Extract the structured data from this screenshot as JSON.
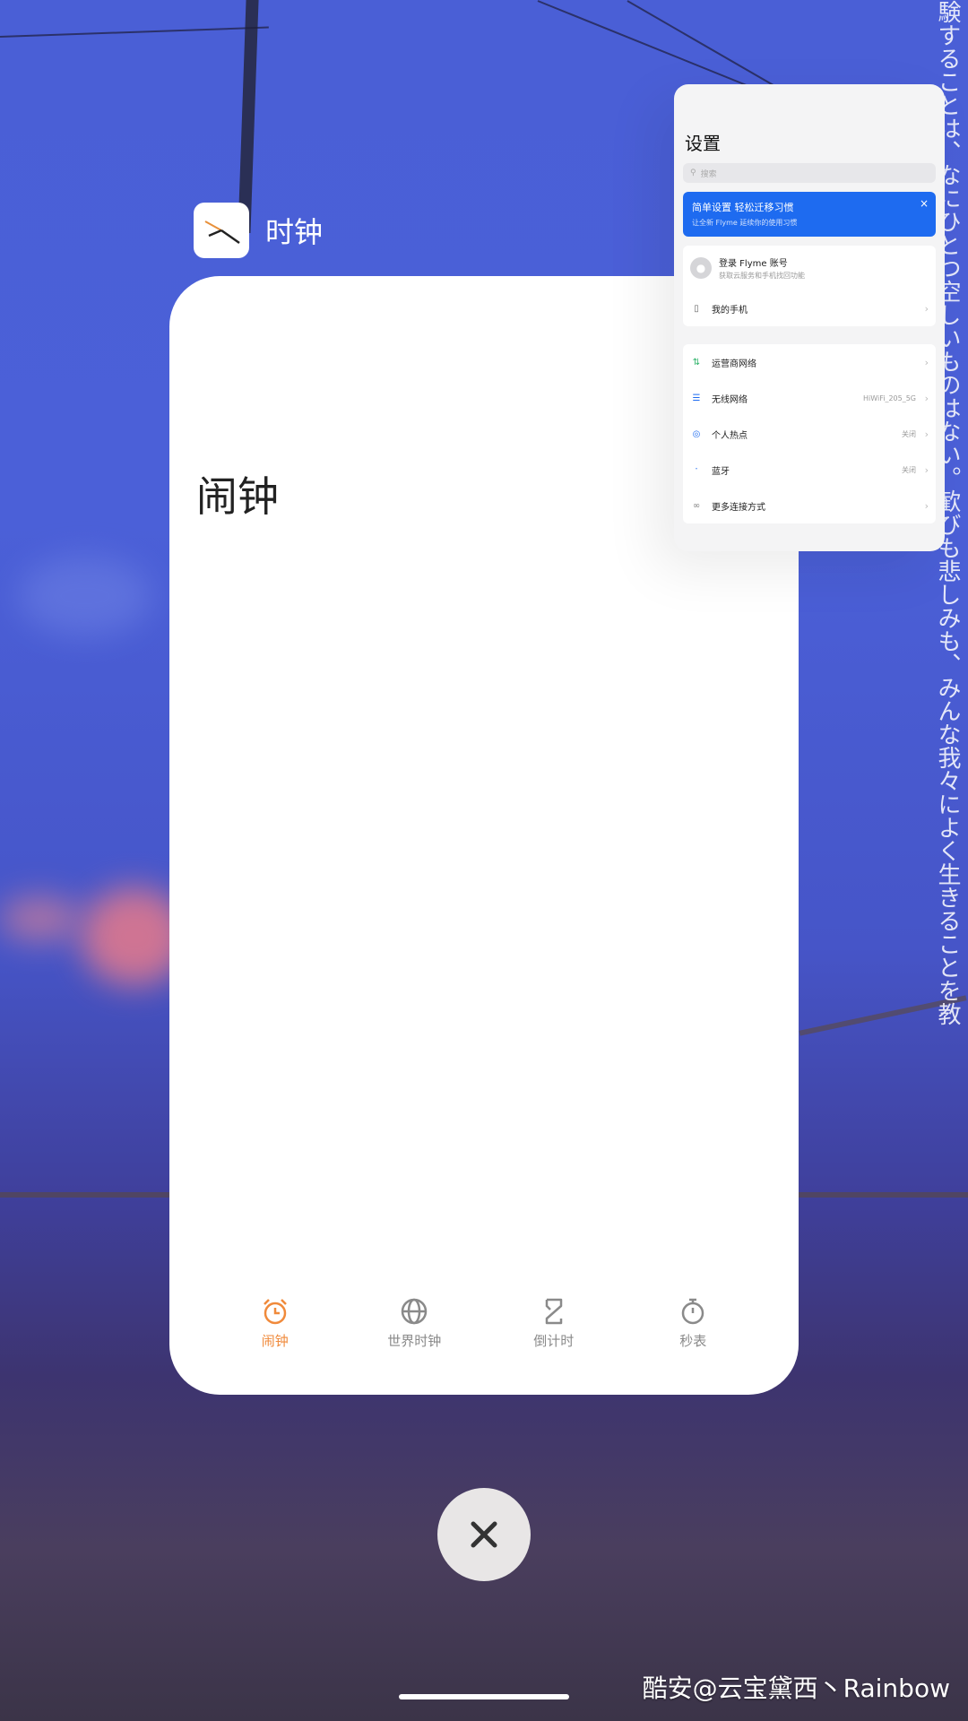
{
  "wallpaper": {
    "vertical_text": "験することは、なにひとつ空しいものはない。歓びも悲しみも、みんな我々によく生きることを教えてくれる。"
  },
  "clock_app": {
    "title": "时钟",
    "page_title": "闹钟",
    "nav": [
      {
        "label": "闹钟",
        "icon": "alarm-icon",
        "active": true
      },
      {
        "label": "世界时钟",
        "icon": "globe-icon",
        "active": false
      },
      {
        "label": "倒计时",
        "icon": "hourglass-icon",
        "active": false
      },
      {
        "label": "秒表",
        "icon": "stopwatch-icon",
        "active": false
      }
    ],
    "accent_color": "#f08a3b"
  },
  "settings_app": {
    "title": "设置",
    "search_placeholder": "搜索",
    "banner": {
      "title": "简单设置 轻松迁移习惯",
      "subtitle": "让全新 Flyme 延续你的使用习惯",
      "close": "×"
    },
    "account": {
      "name": "登录 Flyme 账号",
      "desc": "获取云服务和手机找回功能"
    },
    "my_phone": "我的手机",
    "rows": [
      {
        "label": "运营商网络",
        "value": "",
        "icon": "signal-icon"
      },
      {
        "label": "无线网络",
        "value": "HiWiFi_205_5G",
        "icon": "wifi-icon"
      },
      {
        "label": "个人热点",
        "value": "关闭",
        "icon": "hotspot-icon"
      },
      {
        "label": "蓝牙",
        "value": "关闭",
        "icon": "bluetooth-icon"
      },
      {
        "label": "更多连接方式",
        "value": "",
        "icon": "link-icon"
      }
    ],
    "banner_color": "#1e6bf0"
  },
  "close_button": "✕",
  "watermark": "酷安@云宝黛西丶Rainbow"
}
